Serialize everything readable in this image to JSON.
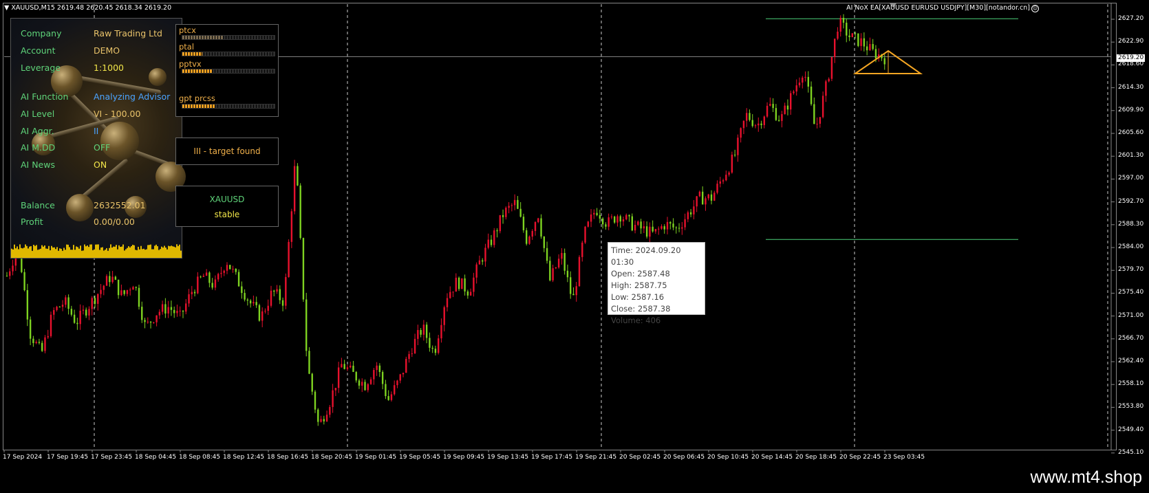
{
  "header": {
    "symbol_line": "XAUUSD,M15  2619.48 2620.45 2618.34 2619.20",
    "ea_title": "AI NoX EA[XAUUSD EURUSD USDJPY][M30][notandor.cn]"
  },
  "info_panel": {
    "rows": [
      {
        "key": "Company",
        "value": "Raw Trading Ltd"
      },
      {
        "key": "Account",
        "value": "DEMO"
      },
      {
        "key": "Leverage",
        "value": "1:1000"
      },
      {
        "key": "AI Function",
        "value": "Analyzing Advisor"
      },
      {
        "key": "AI Level",
        "value": "VI - 100.00"
      },
      {
        "key": "AI Aggr.",
        "value": "II"
      },
      {
        "key": "AI M.DD",
        "value": "OFF"
      },
      {
        "key": "AI News",
        "value": "ON"
      },
      {
        "key": "Balance",
        "value": "2632552.01"
      },
      {
        "key": "Profit",
        "value": "0.00/0.00"
      }
    ]
  },
  "progress_panel": {
    "items": [
      {
        "label": "ptcx",
        "fill": 0.45,
        "style": "gray"
      },
      {
        "label": "ptal",
        "fill": 0.22,
        "style": "orange"
      },
      {
        "label": "pptvx",
        "fill": 0.32,
        "style": "orange"
      },
      {
        "label": "gpt prcss",
        "fill": 0.35,
        "style": "orange"
      }
    ]
  },
  "target_box": {
    "text": "III - target found"
  },
  "symbol_box": {
    "symbol": "XAUUSD",
    "status": "stable"
  },
  "tooltip": {
    "time": "Time: 2024.09.20 01:30",
    "open": "Open: 2587.48",
    "high": "High: 2587.75",
    "low": "Low:  2587.16",
    "close": "Close: 2587.38",
    "volume": "Volume: 406"
  },
  "price_axis": [
    "2627.20",
    "2622.90",
    "2618.60",
    "2614.30",
    "2609.90",
    "2605.60",
    "2601.30",
    "2597.00",
    "2592.70",
    "2588.30",
    "2584.00",
    "2579.70",
    "2575.40",
    "2571.00",
    "2566.70",
    "2562.40",
    "2558.10",
    "2553.80",
    "2549.40",
    "2545.10"
  ],
  "current_price": "2619.20",
  "time_axis": [
    "17 Sep 2024",
    "17 Sep 19:45",
    "17 Sep 23:45",
    "18 Sep 04:45",
    "18 Sep 08:45",
    "18 Sep 12:45",
    "18 Sep 16:45",
    "18 Sep 20:45",
    "19 Sep 01:45",
    "19 Sep 05:45",
    "19 Sep 09:45",
    "19 Sep 13:45",
    "19 Sep 17:45",
    "19 Sep 21:45",
    "20 Sep 02:45",
    "20 Sep 06:45",
    "20 Sep 10:45",
    "20 Sep 14:45",
    "20 Sep 18:45",
    "20 Sep 22:45",
    "23 Sep 03:45"
  ],
  "chart_data": {
    "type": "candlestick",
    "symbol": "XAUUSD",
    "timeframe": "M15",
    "ylim": [
      2545.1,
      2627.2
    ],
    "bullish_color": "#e8112d",
    "bearish_color": "#7ed321",
    "price_path": [
      2577,
      2583,
      2566,
      2562,
      2570,
      2572,
      2568,
      2571,
      2574,
      2577,
      2573,
      2576,
      2567,
      2570,
      2571,
      2569,
      2574,
      2577,
      2575,
      2580,
      2576,
      2572,
      2569,
      2574,
      2572,
      2600,
      2560,
      2548,
      2553,
      2560,
      2558,
      2556,
      2560,
      2553,
      2557,
      2563,
      2567,
      2562,
      2573,
      2576,
      2574,
      2580,
      2584,
      2589,
      2591,
      2584,
      2589,
      2576,
      2581,
      2572,
      2585,
      2590,
      2587,
      2589,
      2587,
      2586,
      2585,
      2587,
      2586,
      2589,
      2592,
      2592,
      2596,
      2600,
      2608,
      2606,
      2610,
      2607,
      2612,
      2617,
      2605,
      2614,
      2626,
      2623,
      2622,
      2620,
      2619
    ],
    "horizontal_lines": [
      2626.5,
      2584.0
    ],
    "current_price": 2619.2,
    "triangle_pattern": {
      "color": "#f5a623"
    }
  },
  "watermark": "www.mt4.shop"
}
